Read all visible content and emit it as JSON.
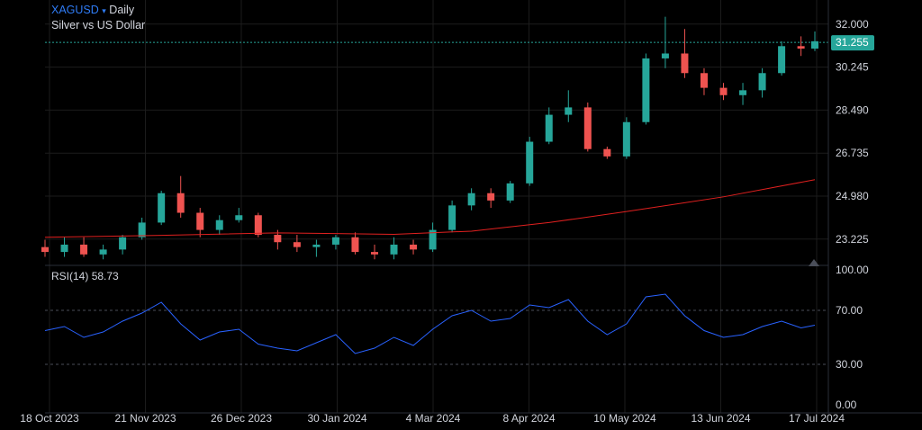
{
  "header": {
    "symbol": "XAGUSD",
    "caret": "▾",
    "interval": "Daily",
    "name": "Silver vs US Dollar"
  },
  "colors": {
    "background": "#000000",
    "up_candle": "#26a69a",
    "down_candle": "#ef5350",
    "moving_average": "#e0201f",
    "rsi_line": "#2962ff",
    "price_tag": "#26a69a",
    "grid": "#1c1c1c",
    "text": "#d1d4dc"
  },
  "price_axis": {
    "ticks": [
      "32.000",
      "30.245",
      "28.490",
      "26.735",
      "24.980",
      "23.225"
    ],
    "current_price": "31.255"
  },
  "rsi": {
    "label": "RSI(14)",
    "value": "58.73",
    "ticks": [
      "100.00",
      "70.00",
      "30.00",
      "0.00"
    ]
  },
  "x_axis": {
    "dates": [
      "18 Oct 2023",
      "21 Nov 2023",
      "26 Dec 2023",
      "30 Jan 2024",
      "4 Mar 2024",
      "8 Apr 2024",
      "10 May 2024",
      "13 Jun 2024",
      "17 Jul 2024"
    ]
  },
  "chart_data": {
    "type": "line",
    "title": "XAGUSD Daily",
    "subtitle": "Silver vs US Dollar",
    "price_range": [
      22.3,
      32.8
    ],
    "rsi_range": [
      0,
      100
    ],
    "rsi_levels": [
      70,
      30
    ],
    "series": [
      {
        "kind": "candlestick",
        "x": [
          "2023-10-13",
          "2023-10-20",
          "2023-10-27",
          "2023-11-03",
          "2023-11-10",
          "2023-11-17",
          "2023-11-24",
          "2023-12-01",
          "2023-12-08",
          "2023-12-15",
          "2023-12-22",
          "2023-12-29",
          "2024-01-05",
          "2024-01-12",
          "2024-01-19",
          "2024-01-26",
          "2024-02-02",
          "2024-02-09",
          "2024-02-16",
          "2024-02-23",
          "2024-03-01",
          "2024-03-08",
          "2024-03-15",
          "2024-03-22",
          "2024-03-29",
          "2024-04-05",
          "2024-04-12",
          "2024-04-19",
          "2024-04-26",
          "2024-05-03",
          "2024-05-10",
          "2024-05-17",
          "2024-05-24",
          "2024-05-31",
          "2024-06-07",
          "2024-06-14",
          "2024-06-21",
          "2024-06-28",
          "2024-07-05",
          "2024-07-12",
          "2024-07-17"
        ],
        "open": [
          22.9,
          22.7,
          23.0,
          22.6,
          22.8,
          23.3,
          23.9,
          25.1,
          24.3,
          23.6,
          24.0,
          24.2,
          23.4,
          23.1,
          22.9,
          23.0,
          23.3,
          22.7,
          22.6,
          23.0,
          22.8,
          23.6,
          24.6,
          25.1,
          24.8,
          25.5,
          27.2,
          28.3,
          28.6,
          26.9,
          26.6,
          28.0,
          30.6,
          30.8,
          30.0,
          29.4,
          29.1,
          29.3,
          30.0,
          31.1,
          31.0
        ],
        "high": [
          23.2,
          23.3,
          23.3,
          23.0,
          23.4,
          24.1,
          25.2,
          25.8,
          24.5,
          24.2,
          24.5,
          24.3,
          23.6,
          23.4,
          23.2,
          23.4,
          23.5,
          23.0,
          23.3,
          23.2,
          23.9,
          24.8,
          25.3,
          25.3,
          25.6,
          27.4,
          28.6,
          29.3,
          28.8,
          27.0,
          28.2,
          30.8,
          32.3,
          31.8,
          30.2,
          29.6,
          29.6,
          30.2,
          31.3,
          31.5,
          31.7
        ],
        "low": [
          22.5,
          22.5,
          22.5,
          22.4,
          22.6,
          23.2,
          23.8,
          24.1,
          23.3,
          23.4,
          23.9,
          23.3,
          22.8,
          22.7,
          22.5,
          22.8,
          22.6,
          22.4,
          22.4,
          22.6,
          22.7,
          23.5,
          24.4,
          24.5,
          24.7,
          25.4,
          27.1,
          28.0,
          26.8,
          26.5,
          26.5,
          27.9,
          30.2,
          29.8,
          29.1,
          28.9,
          28.7,
          29.0,
          29.9,
          30.7,
          30.9
        ],
        "close": [
          22.7,
          23.0,
          22.6,
          22.8,
          23.3,
          23.9,
          25.1,
          24.3,
          23.6,
          24.0,
          24.2,
          23.4,
          23.1,
          22.9,
          23.0,
          23.3,
          22.7,
          22.6,
          23.0,
          22.8,
          23.6,
          24.6,
          25.1,
          24.8,
          25.5,
          27.2,
          28.3,
          28.6,
          26.9,
          26.6,
          28.0,
          30.6,
          30.8,
          30.0,
          29.4,
          29.1,
          29.3,
          30.0,
          31.1,
          31.0,
          31.3
        ]
      },
      {
        "kind": "moving-average",
        "x": [
          "2023-10-13",
          "2023-11-24",
          "2024-01-05",
          "2024-02-16",
          "2024-03-15",
          "2024-04-12",
          "2024-05-10",
          "2024-06-14",
          "2024-07-17"
        ],
        "values": [
          23.3,
          23.38,
          23.48,
          23.42,
          23.55,
          23.9,
          24.35,
          24.95,
          25.65
        ]
      },
      {
        "kind": "rsi",
        "x": [
          "2023-10-13",
          "2023-10-20",
          "2023-10-27",
          "2023-11-03",
          "2023-11-10",
          "2023-11-17",
          "2023-11-24",
          "2023-12-01",
          "2023-12-08",
          "2023-12-15",
          "2023-12-22",
          "2023-12-29",
          "2024-01-05",
          "2024-01-12",
          "2024-01-19",
          "2024-01-26",
          "2024-02-02",
          "2024-02-09",
          "2024-02-16",
          "2024-02-23",
          "2024-03-01",
          "2024-03-08",
          "2024-03-15",
          "2024-03-22",
          "2024-03-29",
          "2024-04-05",
          "2024-04-12",
          "2024-04-19",
          "2024-04-26",
          "2024-05-03",
          "2024-05-10",
          "2024-05-17",
          "2024-05-24",
          "2024-05-31",
          "2024-06-07",
          "2024-06-14",
          "2024-06-21",
          "2024-06-28",
          "2024-07-05",
          "2024-07-12",
          "2024-07-17"
        ],
        "values": [
          55,
          58,
          50,
          54,
          62,
          68,
          76,
          60,
          48,
          54,
          56,
          45,
          42,
          40,
          46,
          52,
          38,
          42,
          50,
          44,
          56,
          66,
          70,
          62,
          64,
          74,
          72,
          78,
          62,
          52,
          60,
          80,
          82,
          66,
          55,
          50,
          52,
          58,
          62,
          57,
          59
        ]
      }
    ]
  }
}
